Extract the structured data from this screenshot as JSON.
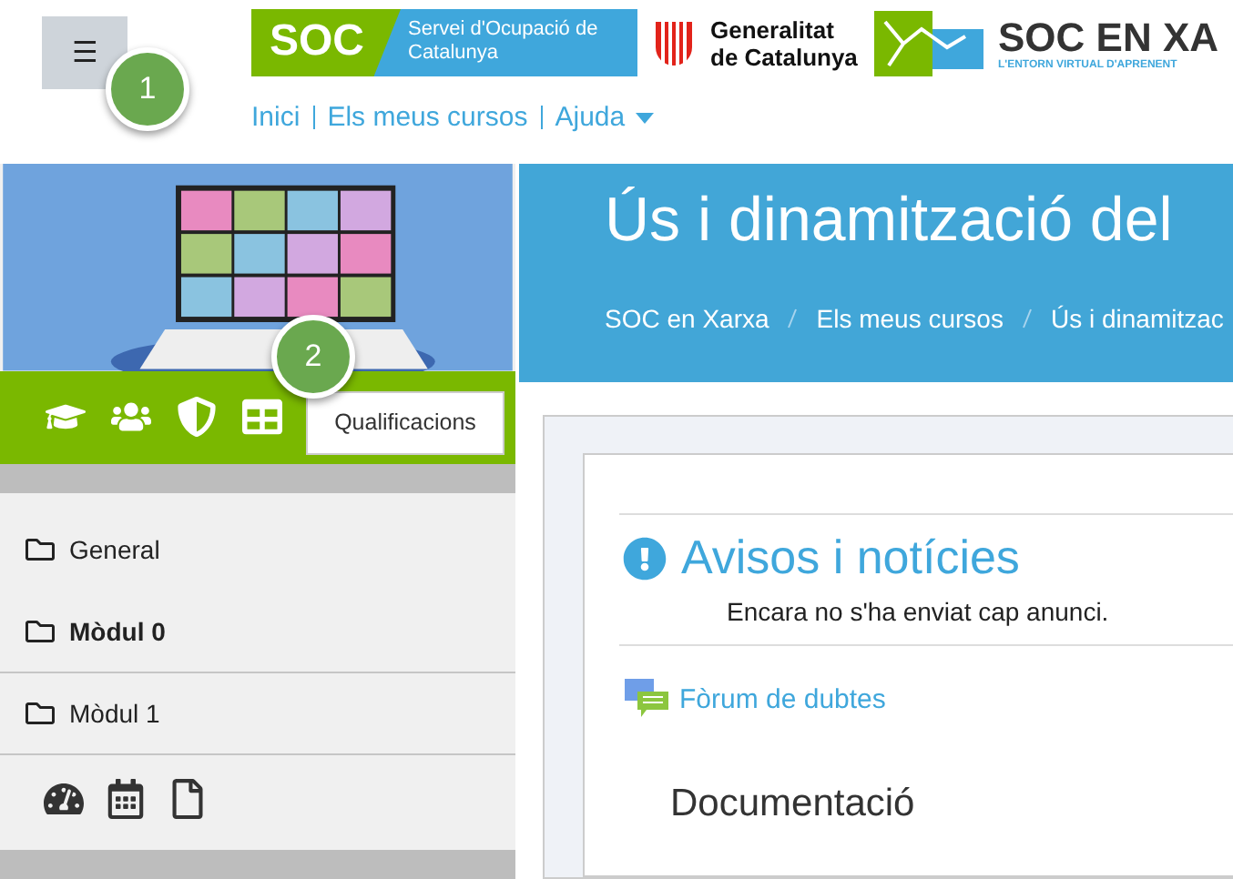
{
  "header": {
    "menu_button": "☰",
    "logos": {
      "soc": "SOC",
      "soc_name": "Servei d'Ocupació de Catalunya",
      "gencat": "Generalitat de Catalunya",
      "soc_en_xarxa": "SOC EN XA",
      "soc_en_xarxa_tagline": "L'ENTORN VIRTUAL D'APRENENT"
    },
    "nav": [
      {
        "label": "Inici",
        "dropdown": false
      },
      {
        "label": "Els meus cursos",
        "dropdown": false
      },
      {
        "label": "Ajuda",
        "dropdown": true
      }
    ]
  },
  "callouts": [
    "1",
    "2"
  ],
  "sidebar": {
    "tooltip": "Qualificacions",
    "sections": [
      {
        "label": "General",
        "current": false
      },
      {
        "label": "Mòdul 0",
        "current": true
      },
      {
        "label": "Mòdul 1",
        "current": false
      }
    ]
  },
  "course": {
    "title": "Ús i dinamització del",
    "breadcrumb": [
      "SOC en Xarxa",
      "Els meus cursos",
      "Ús i dinamitzac"
    ]
  },
  "announcements": {
    "title": "Avisos i notícies",
    "message": "Encara no s'ha enviat cap anunci."
  },
  "forum_link": "Fòrum de dubtes",
  "section_heading": "Documentació"
}
